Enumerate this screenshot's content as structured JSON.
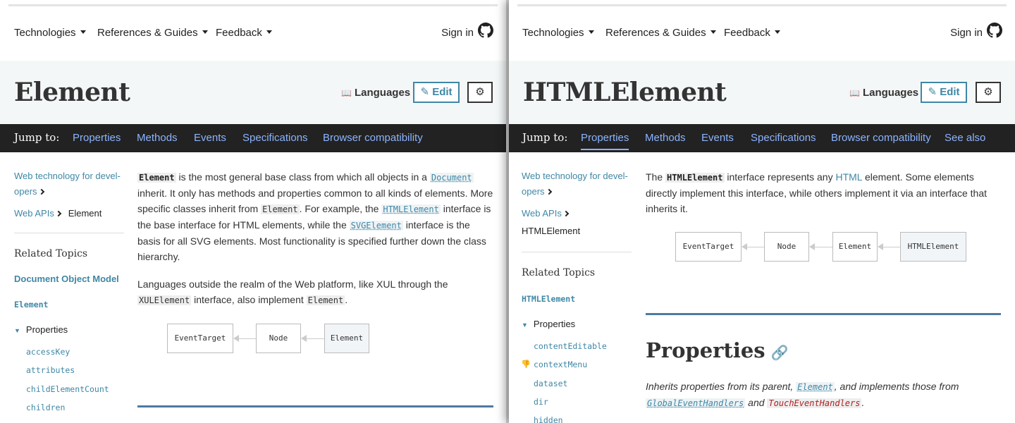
{
  "left": {
    "nav": {
      "technologies": "Technologies",
      "references": "References & Guides",
      "feedback": "Feedback",
      "sign_in": "Sign in"
    },
    "title": "Element",
    "languages": "Languages",
    "edit": "Edit",
    "jump": {
      "label": "Jump to:",
      "links": [
        "Properties",
        "Methods",
        "Events",
        "Specifications",
        "Browser compatibility"
      ]
    },
    "sidebar": {
      "crumb1a": "Web technology for devel-",
      "crumb1b": "opers",
      "crumb2": "Web APIs",
      "current": "Element",
      "related": "Related Topics",
      "dom": "Document Object Model",
      "element": "Element",
      "properties": "Properties",
      "items": [
        "accessKey",
        "attributes",
        "childElementCount",
        "children"
      ]
    },
    "intro": {
      "code_element": "Element",
      "t1": " is the most general base class from which all objects in a ",
      "code_document": "Document",
      "t2": " inherit. It only has methods and properties common to all kinds of elements. More specific classes inherit from ",
      "code_element2": "Element",
      "t3": ". For example, the ",
      "code_html": "HTMLElement",
      "t4": " interface is the base interface for HTML elements, while the ",
      "code_svg": "SVGElement",
      "t5": " interface is the basis for all SVG elements. Most functionality is specified further down the class hierarchy."
    },
    "para2": {
      "t1": "Languages outside the realm of the Web platform, like XUL through the ",
      "code_xul": "XULElement",
      "t2": " interface, also implement ",
      "code_element": "Element",
      "t3": "."
    },
    "diagram": [
      "EventTarget",
      "Node",
      "Element"
    ]
  },
  "right": {
    "nav": {
      "technologies": "Technologies",
      "references": "References & Guides",
      "feedback": "Feedback",
      "sign_in": "Sign in"
    },
    "title": "HTMLElement",
    "languages": "Languages",
    "edit": "Edit",
    "jump": {
      "label": "Jump to:",
      "links": [
        "Properties",
        "Methods",
        "Events",
        "Specifications",
        "Browser compatibility",
        "See also"
      ],
      "active": "Properties"
    },
    "sidebar": {
      "crumb1a": "Web technology for devel-",
      "crumb1b": "opers",
      "crumb2": "Web APIs",
      "current": "HTMLElement",
      "related": "Related Topics",
      "htmlelement": "HTMLElement",
      "properties": "Properties",
      "items": [
        "contentEditable",
        "contextMenu",
        "dataset",
        "dir",
        "hidden"
      ]
    },
    "intro": {
      "t1": "The ",
      "code_html": "HTMLElement",
      "t2": " interface represents any ",
      "link_html": "HTML",
      "t3": " element. Some elements directly implement this interface, while others implement it via an interface that inherits it."
    },
    "diagram": [
      "EventTarget",
      "Node",
      "Element",
      "HTMLElement"
    ],
    "properties_heading": "Properties",
    "inherits": {
      "t1": "Inherits properties from its parent, ",
      "code_element": "Element",
      "t2": ", and implements those from ",
      "code_geh": "GlobalEventHandlers",
      "t3": " and ",
      "code_teh": "TouchEventHandlers",
      "t4": "."
    }
  }
}
